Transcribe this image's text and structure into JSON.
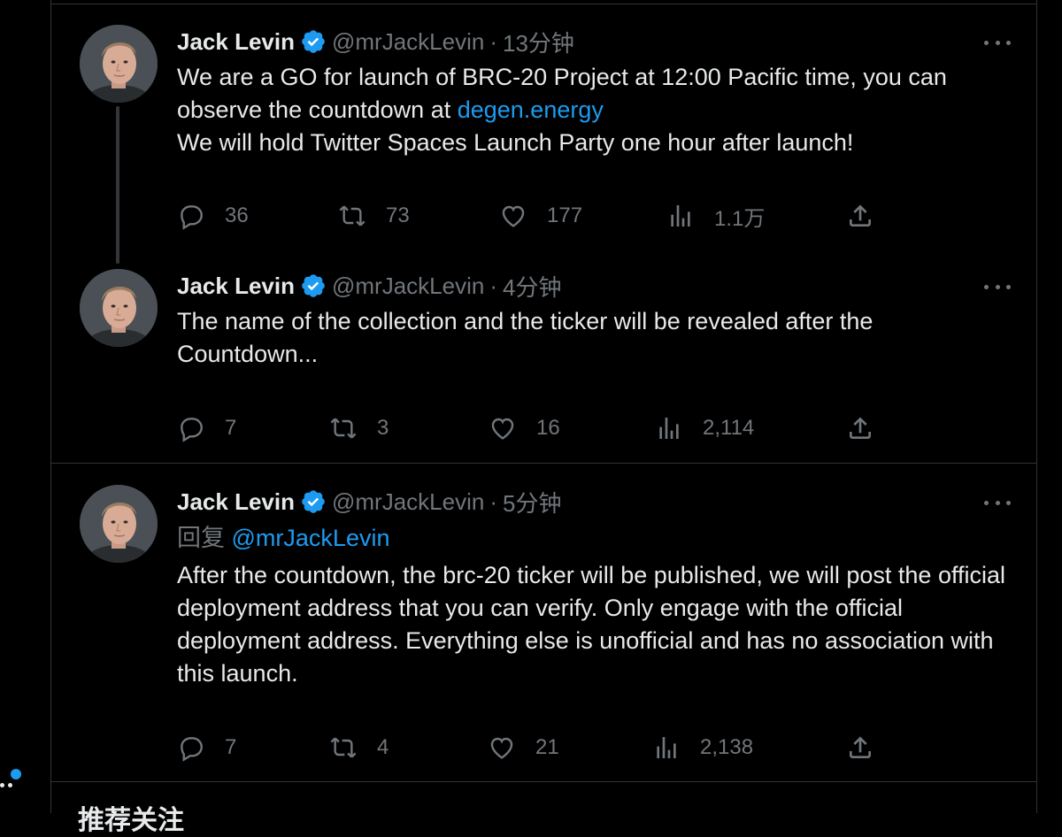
{
  "tweets": [
    {
      "name": "Jack Levin",
      "handle": "@mrJackLevin",
      "separator": "·",
      "time": "13分钟",
      "text_before_link": "We are a GO for launch of BRC-20 Project at 12:00 Pacific time, you can observe the countdown at ",
      "link": "degen.energy",
      "text_after_link": "We will hold Twitter Spaces Launch Party one hour after launch!",
      "replies": "36",
      "retweets": "73",
      "likes": "177",
      "views": "1.1万"
    },
    {
      "name": "Jack Levin",
      "handle": "@mrJackLevin",
      "separator": "·",
      "time": "4分钟",
      "text": "The name of the collection and the ticker will be revealed after the Countdown...",
      "replies": "7",
      "retweets": "3",
      "likes": "16",
      "views": "2,114"
    },
    {
      "name": "Jack Levin",
      "handle": "@mrJackLevin",
      "separator": "·",
      "time": "5分钟",
      "reply_prefix": "回复 ",
      "reply_to": "@mrJackLevin",
      "text": "After the countdown, the brc-20 ticker will be published, we will post the official deployment address that you can verify.  Only engage with the official deployment address.  Everything else is unofficial and has no association with this launch.",
      "replies": "7",
      "retweets": "4",
      "likes": "21",
      "views": "2,138"
    }
  ],
  "bottom_heading": "推荐关注",
  "icons": {
    "reply": "reply-icon",
    "retweet": "retweet-icon",
    "like": "like-icon",
    "views": "views-icon",
    "share": "share-icon",
    "verified": "verified-badge-icon",
    "more": "more-icon"
  },
  "colors": {
    "background": "#000000",
    "text": "#e7e9ea",
    "muted": "#71767b",
    "accent": "#1d9bf0",
    "border": "#2f3336"
  }
}
